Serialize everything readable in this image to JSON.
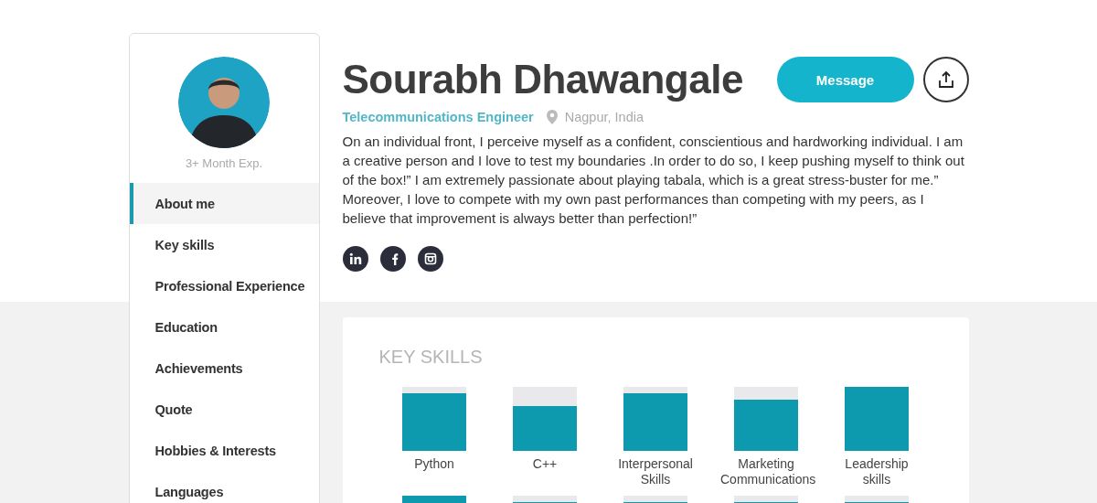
{
  "profile": {
    "experience": "3+ Month Exp.",
    "name": "Sourabh Dhawangale",
    "title": "Telecommunications Engineer",
    "location": "Nagpur, India",
    "bio": "On an individual front, I perceive myself as a confident, conscientious and hardworking individual. I am a creative person and I love to test my boundaries .In order to do so, I keep pushing myself to think out of the box!” I am extremely passionate about playing tabala, which is a great stress-buster for me.” Moreover, I love to compete with my own past performances than competing with my peers, as I believe that improvement is always better than perfection!”",
    "message_button": "Message",
    "socials": [
      {
        "kind": "linkedin"
      },
      {
        "kind": "facebook"
      },
      {
        "kind": "instagram"
      }
    ]
  },
  "sidebar": {
    "items": [
      {
        "label": "About me",
        "selected": true
      },
      {
        "label": "Key skills",
        "selected": false
      },
      {
        "label": "Professional Experience",
        "selected": false
      },
      {
        "label": "Education",
        "selected": false
      },
      {
        "label": "Achievements",
        "selected": false
      },
      {
        "label": "Quote",
        "selected": false
      },
      {
        "label": "Hobbies & Interests",
        "selected": false
      },
      {
        "label": "Languages",
        "selected": false
      }
    ]
  },
  "key_skills": {
    "title": "KEY SKILLS",
    "skills": [
      {
        "name": "Python"
      },
      {
        "name": "C++"
      },
      {
        "name": "Interpersonal Skills"
      },
      {
        "name": "Marketing Communications"
      },
      {
        "name": "Leadership skills"
      }
    ]
  }
}
